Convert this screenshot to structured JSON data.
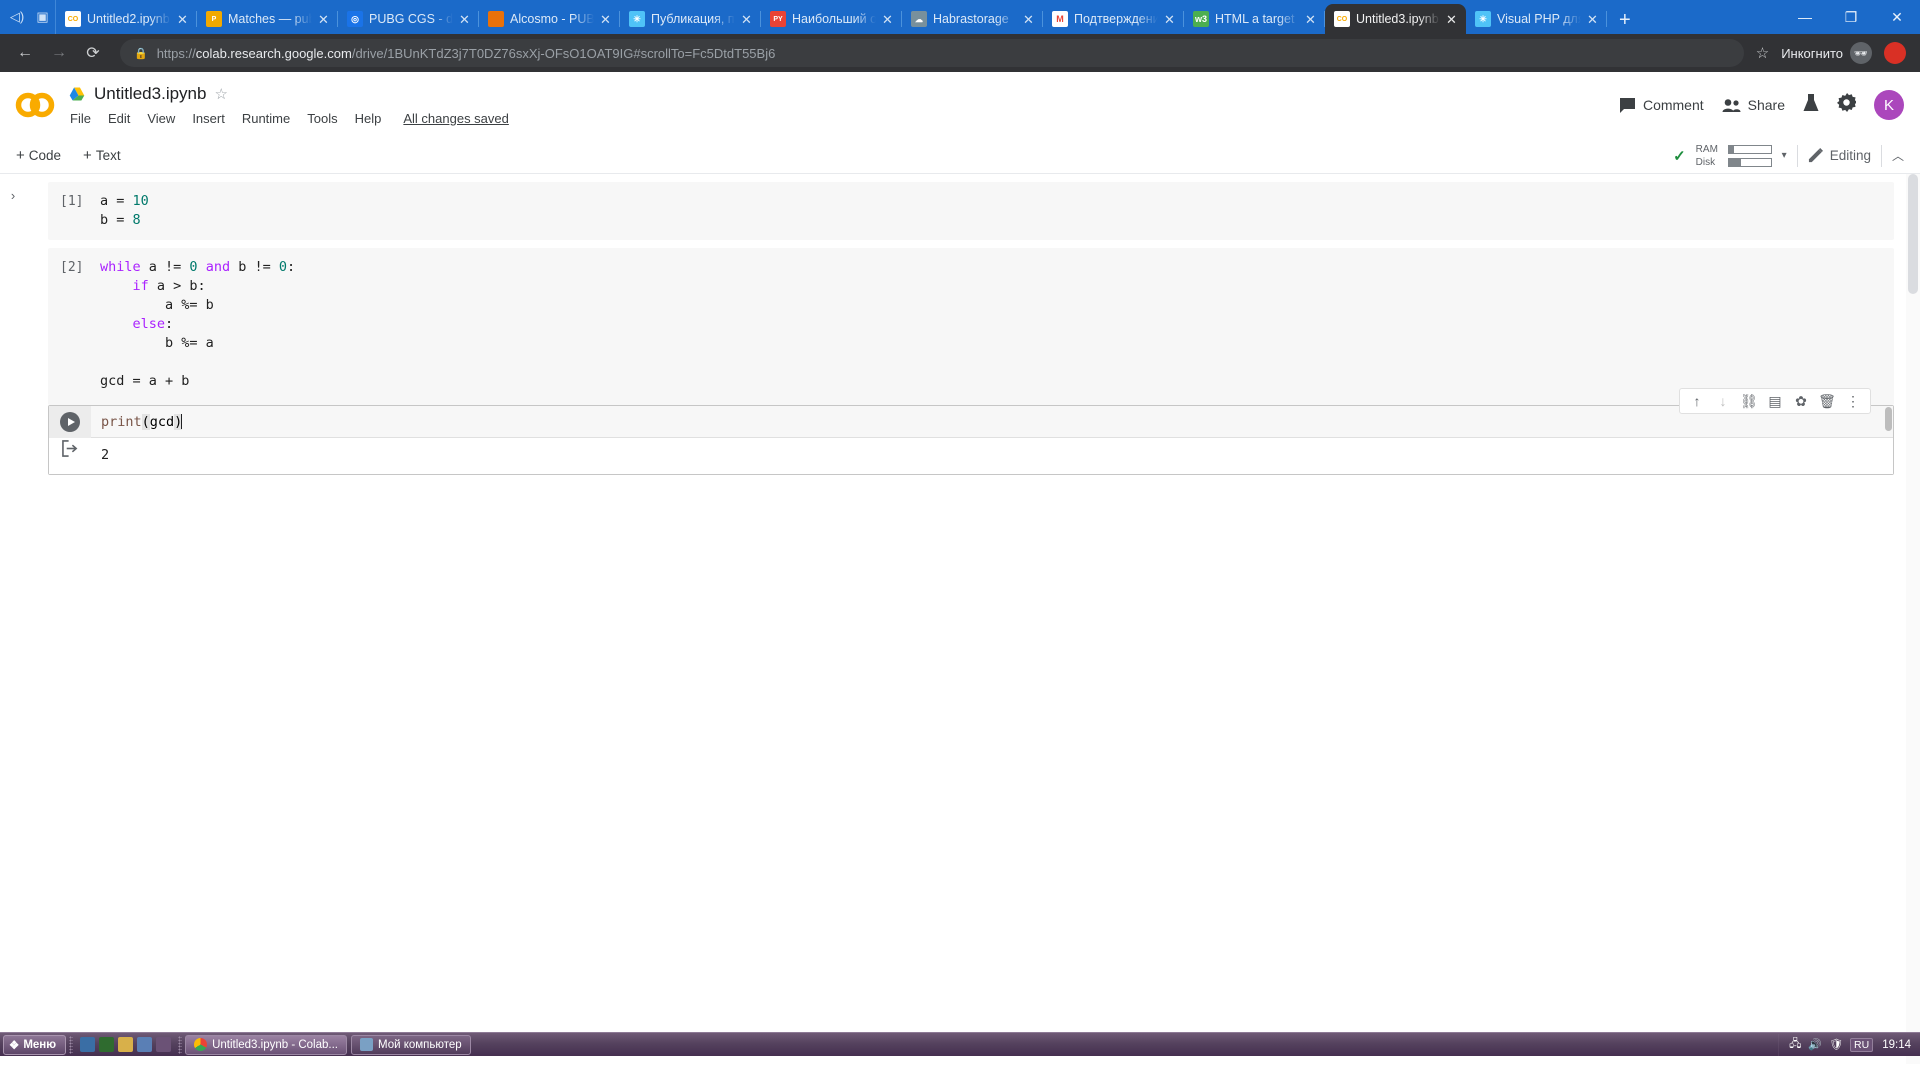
{
  "browser": {
    "tabs": [
      {
        "label": "Untitled2.ipynb",
        "favicon": "colab-icon",
        "color": "#f9ab00",
        "active": false
      },
      {
        "label": "Matches — pub",
        "favicon": "pubg-icon",
        "color": "#f2a900",
        "active": false
      },
      {
        "label": "PUBG CGS - db",
        "favicon": "pubg-cgs-icon",
        "color": "#1a73e8",
        "active": false
      },
      {
        "label": "Alcosmo - PUB",
        "favicon": "alcosmo-icon",
        "color": "#e8710a",
        "active": false
      },
      {
        "label": "Публикация, п",
        "favicon": "snowflake-icon",
        "color": "#4fc3f7",
        "active": false
      },
      {
        "label": "Наибольший о",
        "favicon": "python-ru-icon",
        "color": "#ea4335",
        "active": false
      },
      {
        "label": "Habrastorage",
        "favicon": "habr-icon",
        "color": "#78909c",
        "active": false
      },
      {
        "label": "Подтверждени",
        "favicon": "gmail-icon",
        "color": "#ea4335",
        "active": false
      },
      {
        "label": "HTML a target",
        "favicon": "w3-icon",
        "color": "#4caf50",
        "active": false
      },
      {
        "label": "Untitled3.ipynb",
        "favicon": "colab-icon",
        "color": "#f9ab00",
        "active": true
      },
      {
        "label": "Visual PHP для",
        "favicon": "snowflake-icon",
        "color": "#4fc3f7",
        "active": false
      }
    ],
    "new_tab_label": "+",
    "window_controls": {
      "minimize": "—",
      "maximize": "❐",
      "close": "✕"
    },
    "nav": {
      "back": "←",
      "forward": "→",
      "reload": "⟳"
    },
    "url": {
      "scheme": "https://",
      "host": "colab.research.google.com",
      "path": "/drive/1BUnKTdZ3j7T0DZ76sxXj-OFsO1OAT9IG#scrollTo=Fc5DtdT55Bj6"
    },
    "bookmark_star": "☆",
    "incognito_label": "Инкогнито",
    "profile_initial": ""
  },
  "colab": {
    "notebook_title": "Untitled3.ipynb",
    "star": "☆",
    "menu": [
      "File",
      "Edit",
      "View",
      "Insert",
      "Runtime",
      "Tools",
      "Help"
    ],
    "save_status": "All changes saved",
    "comment_label": "Comment",
    "share_label": "Share",
    "avatar_initial": "K",
    "toolbar": {
      "add_code": "Code",
      "add_text": "Text",
      "plus": "+",
      "connected_check": "✓",
      "ram_label": "RAM",
      "disk_label": "Disk",
      "ram_fill_pct": 12,
      "disk_fill_pct": 30,
      "dropdown_caret": "▾",
      "editing_label": "Editing",
      "collapse_caret": "︿"
    },
    "sidebar_toggle": "›"
  },
  "notebook": {
    "cells": [
      {
        "prompt": "[1]",
        "lines": [
          [
            {
              "t": "a = ",
              "c": "plain"
            },
            {
              "t": "10",
              "c": "num"
            }
          ],
          [
            {
              "t": "b = ",
              "c": "plain"
            },
            {
              "t": "8",
              "c": "num"
            }
          ]
        ]
      },
      {
        "prompt": "[2]",
        "lines": [
          [
            {
              "t": "while",
              "c": "kw"
            },
            {
              "t": " a != ",
              "c": "plain"
            },
            {
              "t": "0",
              "c": "num"
            },
            {
              "t": " ",
              "c": "plain"
            },
            {
              "t": "and",
              "c": "kw"
            },
            {
              "t": " b != ",
              "c": "plain"
            },
            {
              "t": "0",
              "c": "num"
            },
            {
              "t": ":",
              "c": "plain"
            }
          ],
          [
            {
              "t": "    ",
              "c": "plain"
            },
            {
              "t": "if",
              "c": "kw"
            },
            {
              "t": " a > b:",
              "c": "plain"
            }
          ],
          [
            {
              "t": "        a %= b",
              "c": "plain"
            }
          ],
          [
            {
              "t": "    ",
              "c": "plain"
            },
            {
              "t": "else",
              "c": "kw"
            },
            {
              "t": ":",
              "c": "plain"
            }
          ],
          [
            {
              "t": "        b %= a",
              "c": "plain"
            }
          ],
          [
            {
              "t": "",
              "c": "plain"
            }
          ],
          [
            {
              "t": "gcd = a + b",
              "c": "plain"
            }
          ]
        ]
      }
    ],
    "active_cell": {
      "code_fn": "print",
      "code_paren_open": "(",
      "code_arg": "gcd",
      "code_paren_close": ")",
      "output": "2",
      "run_button_title": "run-cell"
    },
    "cell_toolbar_icons": [
      {
        "name": "move-cell-up-icon",
        "glyph": "↑",
        "dim": false
      },
      {
        "name": "move-cell-down-icon",
        "glyph": "↓",
        "dim": true
      },
      {
        "name": "link-to-cell-icon",
        "glyph": "⛓",
        "dim": false
      },
      {
        "name": "add-comment-icon",
        "glyph": "▤",
        "dim": false
      },
      {
        "name": "cell-settings-icon",
        "glyph": "✿",
        "dim": false
      },
      {
        "name": "delete-cell-icon",
        "glyph": "🗑",
        "dim": false
      },
      {
        "name": "more-options-icon",
        "glyph": "⋮",
        "dim": false
      }
    ]
  },
  "taskbar": {
    "start_label": "Меню",
    "items": [
      {
        "label": "Untitled3.ipynb - Colab...",
        "icon": "chrome-icon",
        "selected": true
      },
      {
        "label": "Мой компьютер",
        "icon": "computer-icon",
        "selected": false
      }
    ],
    "language": "RU",
    "clock": "19:14"
  }
}
